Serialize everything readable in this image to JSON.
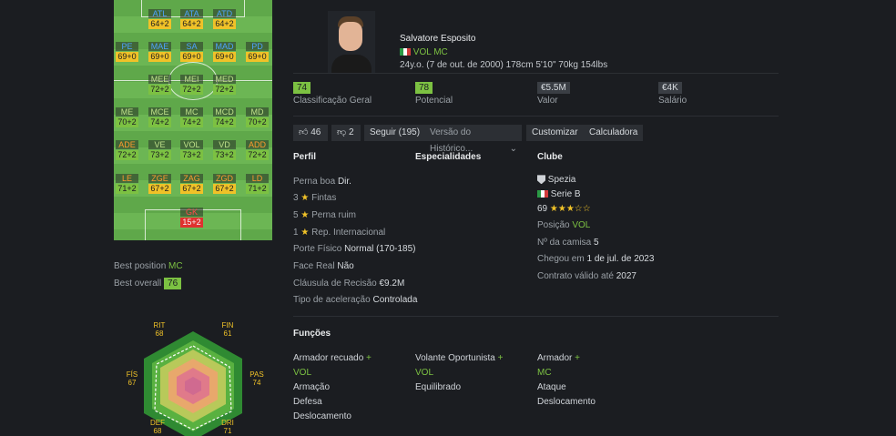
{
  "pitch": {
    "rows": [
      [
        {
          "pos": "ATL",
          "val": "64+2",
          "c": "yellow",
          "p": "blue"
        },
        {
          "pos": "ATA",
          "val": "64+2",
          "c": "yellow",
          "p": "blue"
        },
        {
          "pos": "ATD",
          "val": "64+2",
          "c": "yellow",
          "p": "blue"
        }
      ],
      [
        {
          "pos": "PE",
          "val": "69+0",
          "c": "yellow",
          "p": "blue"
        },
        {
          "pos": "MAE",
          "val": "69+0",
          "c": "yellow",
          "p": "blue"
        },
        {
          "pos": "SA",
          "val": "69+0",
          "c": "yellow",
          "p": "blue"
        },
        {
          "pos": "MAD",
          "val": "69+0",
          "c": "yellow",
          "p": "blue"
        },
        {
          "pos": "PD",
          "val": "69+0",
          "c": "yellow",
          "p": "blue"
        }
      ],
      [
        {
          "pos": "MEE",
          "val": "72+2",
          "c": "green",
          "p": "gr"
        },
        {
          "pos": "MEI",
          "val": "72+2",
          "c": "green",
          "p": "gr"
        },
        {
          "pos": "MED",
          "val": "72+2",
          "c": "green",
          "p": "gr"
        }
      ],
      [
        {
          "pos": "ME",
          "val": "70+2",
          "c": "green",
          "p": "gr"
        },
        {
          "pos": "MCE",
          "val": "74+2",
          "c": "green",
          "p": "gr"
        },
        {
          "pos": "MC",
          "val": "74+2",
          "c": "green",
          "p": "gr"
        },
        {
          "pos": "MCD",
          "val": "74+2",
          "c": "green",
          "p": "gr"
        },
        {
          "pos": "MD",
          "val": "70+2",
          "c": "green",
          "p": "gr"
        }
      ],
      [
        {
          "pos": "ADE",
          "val": "72+2",
          "c": "green",
          "p": "or"
        },
        {
          "pos": "VE",
          "val": "73+2",
          "c": "green",
          "p": "gr"
        },
        {
          "pos": "VOL",
          "val": "73+2",
          "c": "green",
          "p": "gr"
        },
        {
          "pos": "VD",
          "val": "73+2",
          "c": "green",
          "p": "gr"
        },
        {
          "pos": "ADD",
          "val": "72+2",
          "c": "green",
          "p": "or"
        }
      ],
      [
        {
          "pos": "LE",
          "val": "71+2",
          "c": "green",
          "p": "or"
        },
        {
          "pos": "ZGE",
          "val": "67+2",
          "c": "yellow",
          "p": "or"
        },
        {
          "pos": "ZAG",
          "val": "67+2",
          "c": "yellow",
          "p": "or"
        },
        {
          "pos": "ZGD",
          "val": "67+2",
          "c": "yellow",
          "p": "or"
        },
        {
          "pos": "LD",
          "val": "71+2",
          "c": "green",
          "p": "or"
        }
      ],
      [
        {
          "pos": "GK",
          "val": "15+2",
          "c": "red",
          "p": "redp"
        }
      ]
    ]
  },
  "best": {
    "position_label": "Best position",
    "position": "MC",
    "overall_label": "Best overall",
    "overall": "76"
  },
  "radar": {
    "rit": {
      "l": "RIT",
      "v": "68"
    },
    "fin": {
      "l": "FIN",
      "v": "61"
    },
    "fis": {
      "l": "FÍS",
      "v": "67"
    },
    "pas": {
      "l": "PAS",
      "v": "74"
    },
    "def": {
      "l": "DEF",
      "v": "68"
    },
    "dri": {
      "l": "DRI",
      "v": "71"
    }
  },
  "player": {
    "name": "Salvatore Esposito",
    "positions": "VOL MC",
    "info": "24y.o. (7 de out. de 2000) 178cm 5'10\" 70kg 154lbs"
  },
  "stats": [
    {
      "value": "74",
      "label": "Classificação Geral",
      "badge": "#7cc142"
    },
    {
      "value": "78",
      "label": "Potencial",
      "badge": "#7cc142"
    },
    {
      "value": "€5.5M",
      "label": "Valor",
      "badge": "#3a3e44"
    },
    {
      "value": "€4K",
      "label": "Salário",
      "badge": "#3a3e44"
    }
  ],
  "actions": {
    "likes": "46",
    "dislikes": "2",
    "follow": "Seguir (195)",
    "history": "Versão do Histórico...",
    "customize": "Customizar",
    "calculator": "Calculadora"
  },
  "perfil": {
    "title": "Perfil",
    "perna_boa_label": "Perna boa",
    "perna_boa": "Dir.",
    "fintas_n": "3",
    "fintas": "Fintas",
    "perna_ruim_n": "5",
    "perna_ruim": "Perna ruim",
    "rep_n": "1",
    "rep": "Rep. Internacional",
    "porte_label": "Porte Físico",
    "porte": "Normal (170-185)",
    "face_label": "Face Real",
    "face": "Não",
    "clausula_label": "Cláusula de Recisão",
    "clausula": "€9.2M",
    "acel_label": "Tipo de aceleração",
    "acel": "Controlada"
  },
  "especialidades": {
    "title": "Especialidades"
  },
  "clube": {
    "title": "Clube",
    "club": "Spezia",
    "league": "Serie B",
    "rating": "69",
    "stars": "★★★☆☆",
    "posicao_label": "Posição",
    "posicao": "VOL",
    "camisa_label": "Nº da camisa",
    "camisa": "5",
    "chegou_label": "Chegou em",
    "chegou": "1 de jul. de 2023",
    "contrato_label": "Contrato válido até",
    "contrato": "2027"
  },
  "funcoes": {
    "title": "Funções",
    "roles": [
      {
        "name": "Armador recuado",
        "plus": "+",
        "pos": "VOL",
        "lines": [
          "Armação",
          "Defesa",
          "Deslocamento"
        ]
      },
      {
        "name": "Volante Oportunista",
        "plus": "+",
        "pos": "VOL",
        "lines": [
          "Equilibrado"
        ]
      },
      {
        "name": "Armador",
        "plus": "+",
        "pos": "MC",
        "lines": [
          "Ataque",
          "Deslocamento"
        ]
      }
    ]
  }
}
